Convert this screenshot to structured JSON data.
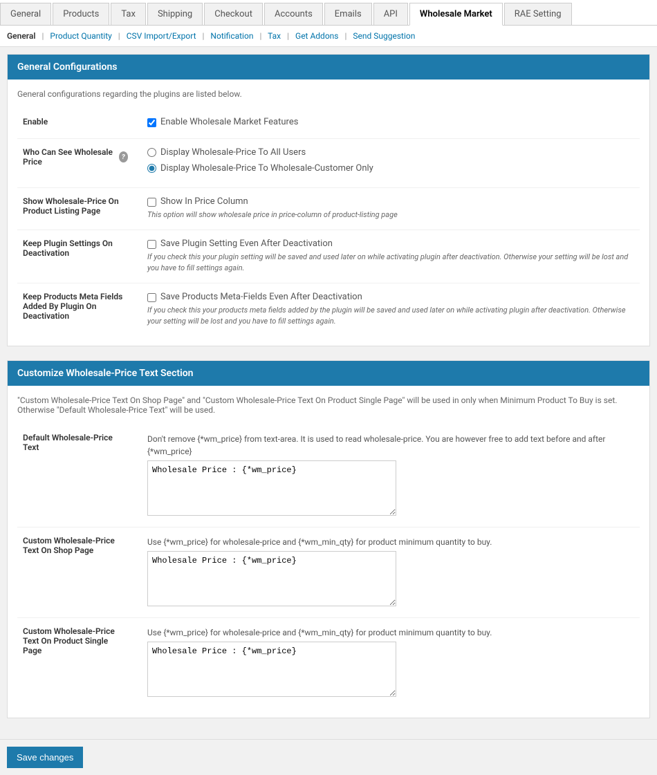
{
  "tabs": {
    "items": [
      {
        "id": "general",
        "label": "General",
        "active": false
      },
      {
        "id": "products",
        "label": "Products",
        "active": false
      },
      {
        "id": "tax",
        "label": "Tax",
        "active": false
      },
      {
        "id": "shipping",
        "label": "Shipping",
        "active": false
      },
      {
        "id": "checkout",
        "label": "Checkout",
        "active": false
      },
      {
        "id": "accounts",
        "label": "Accounts",
        "active": false
      },
      {
        "id": "emails",
        "label": "Emails",
        "active": false
      },
      {
        "id": "api",
        "label": "API",
        "active": false
      },
      {
        "id": "wholesale-market",
        "label": "Wholesale Market",
        "active": true
      },
      {
        "id": "rae-setting",
        "label": "RAE Setting",
        "active": false
      }
    ]
  },
  "subnav": {
    "items": [
      {
        "id": "general-sub",
        "label": "General",
        "current": true
      },
      {
        "id": "product-quantity",
        "label": "Product Quantity",
        "current": false
      },
      {
        "id": "csv-import-export",
        "label": "CSV Import/Export",
        "current": false
      },
      {
        "id": "notification",
        "label": "Notification",
        "current": false
      },
      {
        "id": "tax-sub",
        "label": "Tax",
        "current": false
      },
      {
        "id": "get-addons",
        "label": "Get Addons",
        "current": false
      },
      {
        "id": "send-suggestion",
        "label": "Send Suggestion",
        "current": false
      }
    ]
  },
  "general_config": {
    "section_title": "General Configurations",
    "section_desc": "General configurations regarding the plugins are listed below.",
    "enable_label": "Enable",
    "enable_checkbox_label": "Enable Wholesale Market Features",
    "enable_checked": true,
    "who_can_see_label": "Who Can See Wholesale Price",
    "who_can_see_help": "?",
    "radio_all_users_label": "Display Wholesale-Price To All Users",
    "radio_all_users_checked": false,
    "radio_wholesale_label": "Display Wholesale-Price To Wholesale-Customer Only",
    "radio_wholesale_checked": true,
    "show_price_label": "Show Wholesale-Price On Product Listing Page",
    "show_price_checkbox_label": "Show In Price Column",
    "show_price_checked": false,
    "show_price_hint": "This option will show wholesale price in price-column of product-listing page",
    "keep_plugin_label": "Keep Plugin Settings On Deactivation",
    "keep_plugin_checkbox_label": "Save Plugin Setting Even After Deactivation",
    "keep_plugin_checked": false,
    "keep_plugin_hint": "If you check this your plugin setting will be saved and used later on while activating plugin after deactivation. Otherwise your setting will be lost and you have to fill settings again.",
    "keep_meta_label": "Keep Products Meta Fields Added By Plugin On Deactivation",
    "keep_meta_checkbox_label": "Save Products Meta-Fields Even After Deactivation",
    "keep_meta_checked": false,
    "keep_meta_hint": "If you check this your products meta fields added by the plugin will be saved and used later on while activating plugin after deactivation. Otherwise your setting will be lost and you have to fill settings again."
  },
  "customize_section": {
    "section_title": "Customize Wholesale-Price Text Section",
    "section_intro": "\"Custom Wholesale-Price Text On Shop Page\" and \"Custom Wholesale-Price Text On Product Single Page\" will be used in only when Minimum Product To Buy is set. Otherwise \"Default Wholesale-Price Text\" will be used.",
    "default_text_label": "Default Wholesale-Price Text",
    "default_text_hint": "Don't remove {*wm_price} from text-area. It is used to read wholesale-price. You are however free to add text before and after {*wm_price}",
    "default_text_value": "Wholesale Price : {*wm_price}",
    "custom_shop_label": "Custom Wholesale-Price Text On Shop Page",
    "custom_shop_hint": "Use {*wm_price} for wholesale-price and {*wm_min_qty} for product minimum quantity to buy.",
    "custom_shop_value": "Wholesale Price : {*wm_price}",
    "custom_single_label": "Custom Wholesale-Price Text On Product Single Page",
    "custom_single_hint": "Use {*wm_price} for wholesale-price and {*wm_min_qty} for product minimum quantity to buy.",
    "custom_single_value": "Wholesale Price : {*wm_price}"
  },
  "footer": {
    "save_button_label": "Save changes"
  }
}
